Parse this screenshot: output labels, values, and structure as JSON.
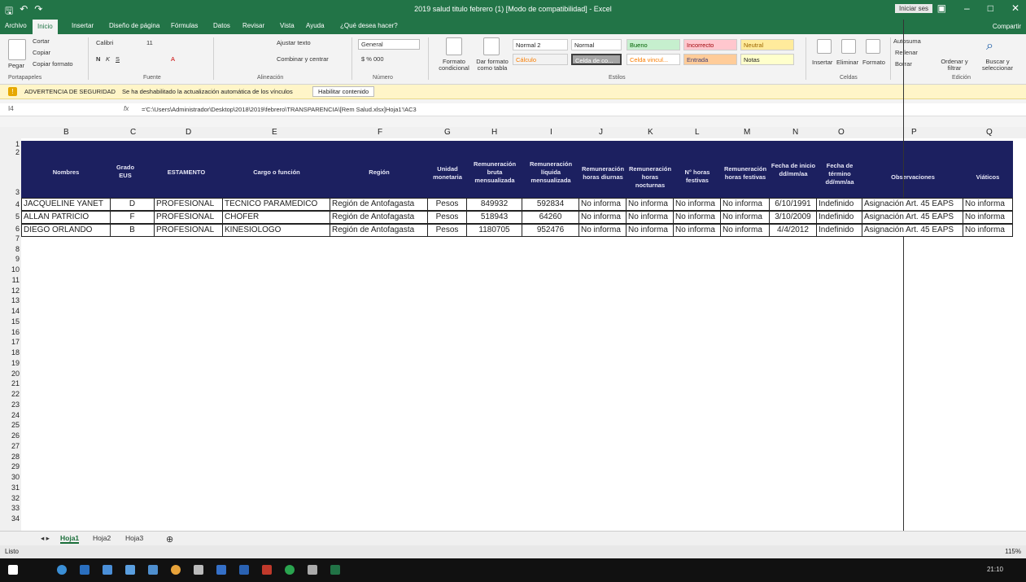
{
  "window": {
    "title": "2019 salud titulo febrero (1) [Modo de compatibilidad] - Excel",
    "signin": "Iniciar ses",
    "qat": [
      "save-icon",
      "undo-icon",
      "redo-icon"
    ]
  },
  "tabs": {
    "items": [
      "Archivo",
      "Inicio",
      "Insertar",
      "Diseño de página",
      "Fórmulas",
      "Datos",
      "Revisar",
      "Vista",
      "Ayuda",
      "¿Qué desea hacer?"
    ],
    "share": "Compartir"
  },
  "ribbon": {
    "clipboard": {
      "paste": "Pegar",
      "cut": "Cortar",
      "copy": "Copiar",
      "format_painter": "Copiar formato",
      "label": "Portapapeles"
    },
    "font": {
      "name": "Calibri",
      "size": "11",
      "label": "Fuente"
    },
    "alignment": {
      "wrap": "Ajustar texto",
      "merge": "Combinar y centrar",
      "label": "Alineación"
    },
    "number": {
      "format": "General",
      "label": "Número"
    },
    "styles": {
      "conditional": "Formato condicional",
      "as_table": "Dar formato como tabla",
      "boxes": [
        "Normal 2",
        "Normal",
        "Bueno",
        "Incorrecto",
        "Neutral",
        "Cálculo",
        "Celda de co...",
        "Celda vincul...",
        "Entrada",
        "Notas"
      ],
      "label": "Estilos"
    },
    "cells": {
      "insert": "Insertar",
      "delete": "Eliminar",
      "format": "Formato",
      "label": "Celdas"
    },
    "editing": {
      "autosum": "Autosuma",
      "fill": "Rellenar",
      "clear": "Borrar",
      "sort": "Ordenar y filtrar",
      "find": "Buscar y seleccionar",
      "label": "Edición"
    }
  },
  "security": {
    "title": "ADVERTENCIA DE SEGURIDAD",
    "message": "Se ha deshabilitado la actualización automática de los vínculos",
    "button": "Habilitar contenido"
  },
  "formula_bar": {
    "name_box": "I4",
    "fx": "fx",
    "formula": "='C:\\Users\\Administrador\\Desktop\\2018\\2019\\febrero\\TRANSPARENCIA\\[Rem Salud.xlsx]Hoja1'!AC3"
  },
  "columns": [
    "B",
    "C",
    "D",
    "E",
    "F",
    "G",
    "H",
    "I",
    "J",
    "K",
    "L",
    "M",
    "N",
    "O",
    "P",
    "Q"
  ],
  "rows": [
    "1",
    "2",
    "3",
    "4",
    "5",
    "6",
    "7",
    "8",
    "9",
    "10",
    "11",
    "12",
    "13",
    "14",
    "15",
    "16",
    "17",
    "18",
    "19",
    "20",
    "21",
    "22",
    "23",
    "24",
    "25",
    "26",
    "27",
    "28",
    "29",
    "30",
    "31",
    "32",
    "33",
    "34"
  ],
  "table": {
    "headers": [
      "Nombres",
      "Grado EUS",
      "ESTAMENTO",
      "Cargo o función",
      "Región",
      "Unidad monetaria",
      "Remuneración bruta mensualizada",
      "Remuneración líquida mensualizada",
      "Remuneración horas diurnas",
      "Remuneración horas nocturnas",
      "N° horas festivas",
      "Remuneración horas festivas",
      "Fecha de inicio dd/mm/aa",
      "Fecha de término dd/mm/aa",
      "Observaciones",
      "Viáticos"
    ],
    "rows": [
      [
        "JACQUELINE YANET",
        "D",
        "PROFESIONAL",
        "TECNICO PARAMEDICO",
        "Región de Antofagasta",
        "Pesos",
        "849932",
        "592834",
        "No informa",
        "No informa",
        "No informa",
        "No informa",
        "6/10/1991",
        "Indefinido",
        "Asignación Art. 45 EAPS",
        "No informa"
      ],
      [
        "ALLAN PATRICIO",
        "F",
        "PROFESIONAL",
        "CHOFER",
        "Región de Antofagasta",
        "Pesos",
        "518943",
        "64260",
        "No informa",
        "No informa",
        "No informa",
        "No informa",
        "3/10/2009",
        "Indefinido",
        "Asignación Art. 45 EAPS",
        "No informa"
      ],
      [
        "DIEGO ORLANDO",
        "B",
        "PROFESIONAL",
        "KINESIOLOGO",
        "Región de Antofagasta",
        "Pesos",
        "1180705",
        "952476",
        "No informa",
        "No informa",
        "No informa",
        "No informa",
        "4/4/2012",
        "Indefinido",
        "Asignación Art. 45 EAPS",
        "No informa"
      ]
    ]
  },
  "sheets": [
    "Hoja1",
    "Hoja2",
    "Hoja3"
  ],
  "status": {
    "ready": "Listo",
    "zoom": "115%"
  },
  "taskbar": {
    "clock": "21:10"
  }
}
